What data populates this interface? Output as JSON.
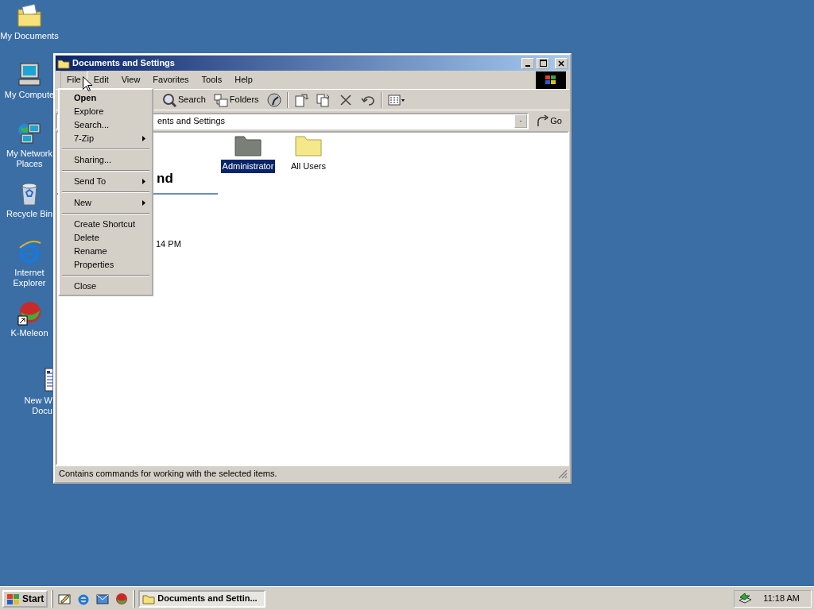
{
  "desktop_icons": [
    {
      "kind": "documents",
      "label": "My Documents"
    },
    {
      "kind": "computer",
      "label": "My Compute"
    },
    {
      "kind": "network",
      "label": "My Network\nPlaces"
    },
    {
      "kind": "recycle",
      "label": "Recycle Bin"
    },
    {
      "kind": "ie",
      "label": "Internet\nExplorer"
    },
    {
      "kind": "meleon",
      "label": "K-Meleon"
    },
    {
      "kind": "document",
      "label": "New W\nDocu"
    }
  ],
  "window": {
    "title": "Documents and Settings",
    "menu": [
      {
        "label": "File",
        "selected": true
      },
      {
        "label": "Edit",
        "selected": false
      },
      {
        "label": "View",
        "selected": false
      },
      {
        "label": "Favorites",
        "selected": false
      },
      {
        "label": "Tools",
        "selected": false
      },
      {
        "label": "Help",
        "selected": false
      }
    ],
    "toolbar": [
      {
        "kind": "search",
        "label": "Search"
      },
      {
        "kind": "folders",
        "label": "Folders"
      },
      {
        "kind": "history"
      },
      {
        "kind": "sep"
      },
      {
        "kind": "move"
      },
      {
        "kind": "copy"
      },
      {
        "kind": "delete"
      },
      {
        "kind": "undo"
      },
      {
        "kind": "sep"
      },
      {
        "kind": "views"
      }
    ],
    "address": {
      "value": "ents and Settings"
    },
    "go_label": "Go",
    "webview": {
      "heading": "nd",
      "detail": "14 PM"
    },
    "items": [
      {
        "label": "Administrator",
        "selected": true
      },
      {
        "label": "All Users",
        "selected": false
      }
    ],
    "status": "Contains commands for working with the selected items."
  },
  "file_menu": [
    {
      "kind": "item",
      "label": "Open",
      "default": true
    },
    {
      "kind": "item",
      "label": "Explore",
      "default": false
    },
    {
      "kind": "item",
      "label": "Search...",
      "default": false
    },
    {
      "kind": "submenu",
      "label": "7-Zip"
    },
    {
      "kind": "separator"
    },
    {
      "kind": "item",
      "label": "Sharing...",
      "default": false
    },
    {
      "kind": "separator"
    },
    {
      "kind": "submenu",
      "label": "Send To"
    },
    {
      "kind": "separator"
    },
    {
      "kind": "submenu",
      "label": "New"
    },
    {
      "kind": "separator"
    },
    {
      "kind": "item",
      "label": "Create Shortcut",
      "default": false
    },
    {
      "kind": "item",
      "label": "Delete",
      "default": false
    },
    {
      "kind": "item",
      "label": "Rename",
      "default": false
    },
    {
      "kind": "item",
      "label": "Properties",
      "default": false
    },
    {
      "kind": "separator"
    },
    {
      "kind": "item",
      "label": "Close",
      "default": false
    }
  ],
  "taskbar": {
    "start": "Start",
    "quick_launch": [
      {
        "kind": "desktop"
      },
      {
        "kind": "ie"
      },
      {
        "kind": "mail"
      },
      {
        "kind": "meleon"
      }
    ],
    "tasks": [
      {
        "label": "Documents and Settin...",
        "selected": true
      }
    ],
    "clock": "11:18 AM"
  }
}
